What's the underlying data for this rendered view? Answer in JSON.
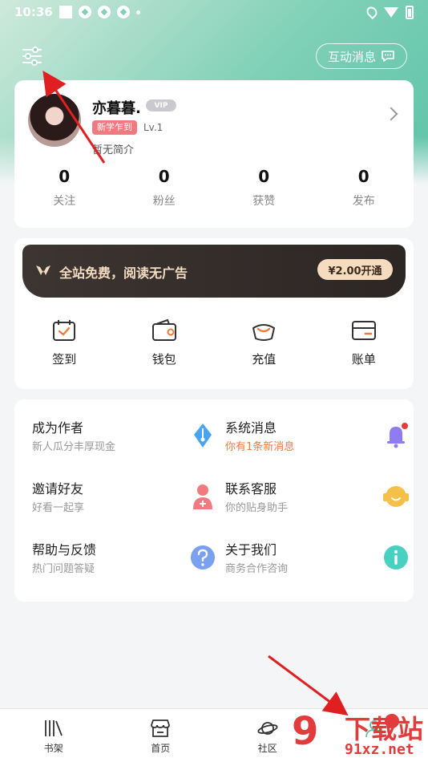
{
  "status_bar": {
    "time": "10:36"
  },
  "header": {
    "messages_label": "互动消息"
  },
  "profile": {
    "nickname": "亦暮暮.",
    "vip_badge": "VIP",
    "tag": "新学乍到",
    "level": "Lv.1",
    "bio": "暂无简介",
    "stats": [
      {
        "value": "0",
        "label": "关注"
      },
      {
        "value": "0",
        "label": "粉丝"
      },
      {
        "value": "0",
        "label": "获赞"
      },
      {
        "value": "0",
        "label": "发布"
      }
    ]
  },
  "vip_banner": {
    "text": "全站免费，阅读无广告",
    "price_button": "¥2.00开通"
  },
  "quick_actions": [
    {
      "label": "签到",
      "icon": "calendar-check-icon"
    },
    {
      "label": "钱包",
      "icon": "wallet-icon"
    },
    {
      "label": "充值",
      "icon": "ingot-icon"
    },
    {
      "label": "账单",
      "icon": "card-icon"
    }
  ],
  "services": [
    {
      "title": "成为作者",
      "subtitle": "新人瓜分丰厚现金",
      "icon": "pen-nib-icon",
      "color": "#4aa3f0"
    },
    {
      "title": "系统消息",
      "subtitle": "你有1条新消息",
      "icon": "bell-icon",
      "color": "#8f7cf0"
    },
    {
      "title": "邀请好友",
      "subtitle": "好看一起享",
      "icon": "person-add-icon",
      "color": "#f07a80"
    },
    {
      "title": "联系客服",
      "subtitle": "你的贴身助手",
      "icon": "headset-icon",
      "color": "#f5c04a"
    },
    {
      "title": "帮助与反馈",
      "subtitle": "热门问题答疑",
      "icon": "question-icon",
      "color": "#7aa0f0"
    },
    {
      "title": "关于我们",
      "subtitle": "商务合作咨询",
      "icon": "info-icon",
      "color": "#4ad0c0"
    }
  ],
  "bottom_nav": [
    {
      "label": "书架",
      "icon": "bookshelf-icon"
    },
    {
      "label": "首页",
      "icon": "store-icon"
    },
    {
      "label": "社区",
      "icon": "planet-icon"
    },
    {
      "label": "",
      "icon": "profile-icon"
    }
  ],
  "watermark": {
    "main": "下载站",
    "sub": "91xz.net",
    "logo": "9"
  },
  "colors": {
    "accent": "#5dc3a8",
    "alert": "#e23b3b",
    "vip_gold": "#f3dcc0"
  }
}
